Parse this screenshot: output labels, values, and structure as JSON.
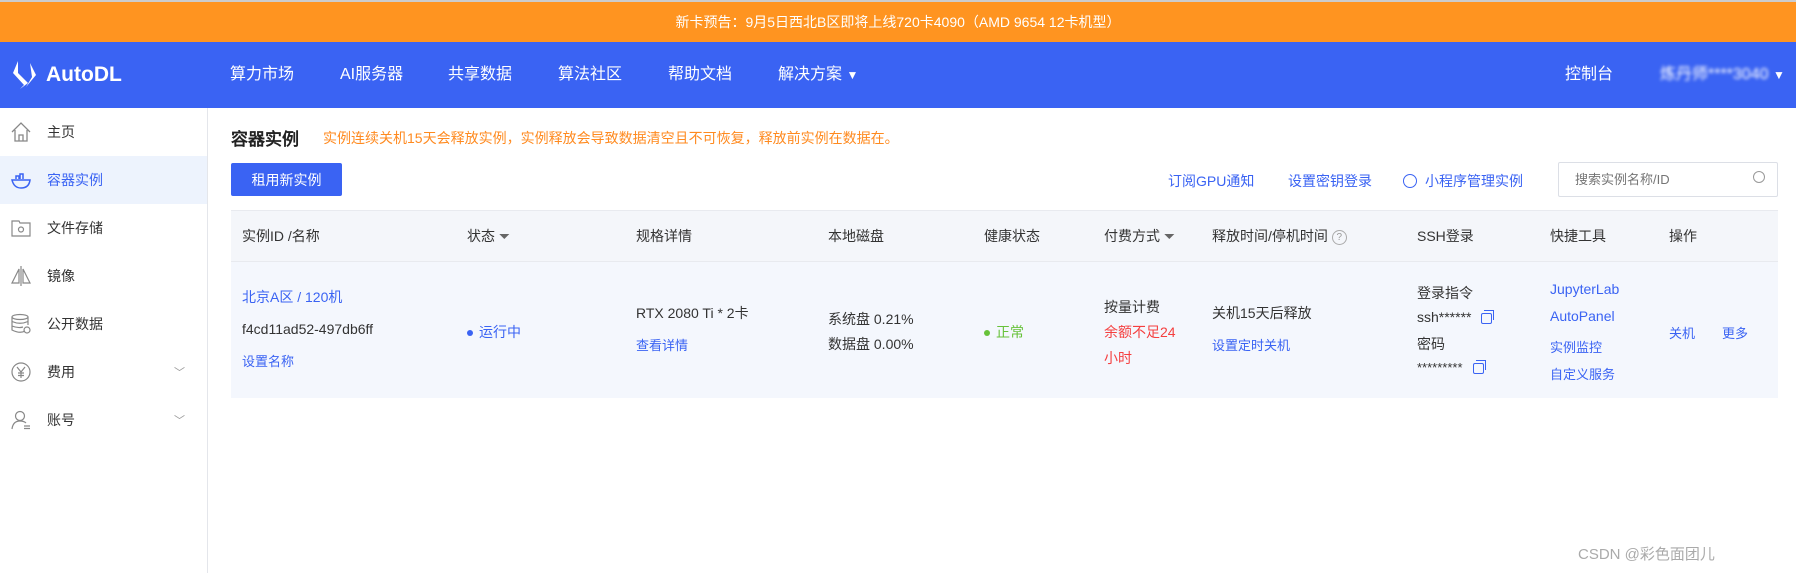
{
  "banner": {
    "text": "新卡预告：9月5日西北B区即将上线720卡4090（AMD 9654 12卡机型）"
  },
  "nav": {
    "logo": "AutoDL",
    "items": [
      "算力市场",
      "AI服务器",
      "共享数据",
      "算法社区",
      "帮助文档",
      "解决方案"
    ],
    "console": "控制台",
    "user": "炼丹师****3040"
  },
  "sidebar": {
    "items": [
      {
        "label": "主页",
        "icon": "home-icon"
      },
      {
        "label": "容器实例",
        "icon": "container-icon",
        "active": true
      },
      {
        "label": "文件存储",
        "icon": "folder-gear-icon"
      },
      {
        "label": "镜像",
        "icon": "mirror-icon"
      },
      {
        "label": "公开数据",
        "icon": "database-icon"
      },
      {
        "label": "费用",
        "icon": "yen-icon",
        "expandable": true
      },
      {
        "label": "账号",
        "icon": "user-icon",
        "expandable": true
      }
    ]
  },
  "page": {
    "title": "容器实例",
    "warning": "实例连续关机15天会释放实例，实例释放会导致数据清空且不可恢复，释放前实例在数据在。",
    "rent_button": "租用新实例",
    "links": {
      "gpu_notify": "订阅GPU通知",
      "ssh_key": "设置密钥登录",
      "miniprogram": "小程序管理实例"
    },
    "search_placeholder": "搜索实例名称/ID"
  },
  "table": {
    "headers": [
      "实例ID /名称",
      "状态",
      "规格详情",
      "本地磁盘",
      "健康状态",
      "付费方式",
      "释放时间/停机时间",
      "SSH登录",
      "快捷工具",
      "操作"
    ],
    "rows": [
      {
        "region": "北京A区 / 120机",
        "id": "f4cd11ad52-497db6ff",
        "set_name": "设置名称",
        "status": "运行中",
        "spec": "RTX 2080 Ti * 2卡",
        "spec_detail": "查看详情",
        "disk_sys": "系统盘 0.21%",
        "disk_data": "数据盘 0.00%",
        "health": "正常",
        "billing": "按量计费",
        "billing_warn_1": "余额不足24",
        "billing_warn_2": "小时",
        "release": "关机15天后释放",
        "schedule_shutdown": "设置定时关机",
        "ssh_cmd_label": "登录指令",
        "ssh_cmd": "ssh******",
        "pwd_label": "密码",
        "pwd": "*********",
        "tools": [
          "JupyterLab",
          "AutoPanel",
          "实例监控",
          "自定义服务"
        ],
        "actions": [
          "关机",
          "更多"
        ]
      }
    ]
  },
  "watermark": "CSDN @彩色面团儿",
  "colors": {
    "banner": "#FF9420",
    "nav": "#3A63F3",
    "link": "#3A63F3",
    "warning": "#FF8A1F",
    "ok": "#67C23A",
    "error": "#F53F3F"
  }
}
